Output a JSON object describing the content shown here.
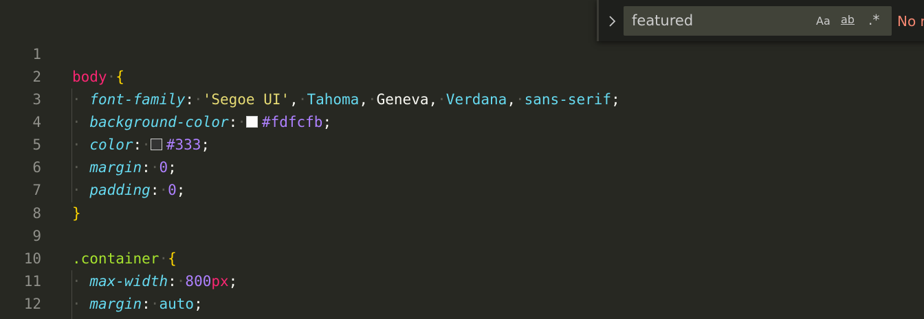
{
  "find_widget": {
    "query": "featured",
    "match_case_label": "Aa",
    "whole_word_label": "ab",
    "regex_label": ".*",
    "status": "No r"
  },
  "line_numbers": [
    "1",
    "2",
    "3",
    "4",
    "5",
    "6",
    "7",
    "8",
    "9",
    "10",
    "11",
    "12"
  ],
  "code": {
    "l2": {
      "sel": "body",
      "brace": "{"
    },
    "l3": {
      "prop": "font-family",
      "v1": "'Segoe UI'",
      "v2": "Tahoma",
      "v3": "Geneva",
      "v4": "Verdana",
      "v5": "sans-serif"
    },
    "l4": {
      "prop": "background-color",
      "val": "#fdfcfb"
    },
    "l5": {
      "prop": "color",
      "val": "#333"
    },
    "l6": {
      "prop": "margin",
      "val": "0"
    },
    "l7": {
      "prop": "padding",
      "val": "0"
    },
    "l8": {
      "brace": "}"
    },
    "l10": {
      "sel": ".container",
      "brace": "{"
    },
    "l11": {
      "prop": "max-width",
      "num": "800",
      "unit": "px"
    },
    "l12": {
      "prop": "margin",
      "val": "auto"
    }
  },
  "colors": {
    "swatch_background": "#fdfcfb",
    "swatch_color": "#333",
    "editor_bg": "#272822"
  }
}
